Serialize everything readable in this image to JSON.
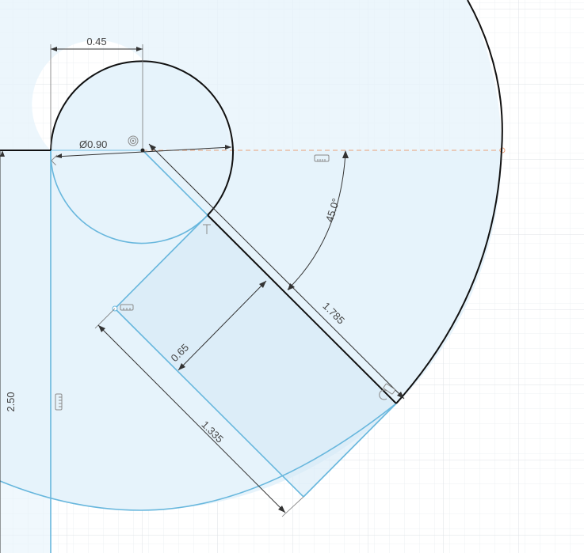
{
  "colors": {
    "background": "#ffffff",
    "grid_minor": "#eef0f3",
    "grid_major": "#dde1e6",
    "region_fill": "#e6f3fb",
    "sketch_line": "#68b7dd",
    "profile_line": "#111111",
    "dimension_line": "#333333",
    "construction_line": "#e8a07a"
  },
  "dimensions": {
    "horizontal_offset": "0.45",
    "circle_diameter": "Ø0.90",
    "angle": "45.0°",
    "edge_length": "1.785",
    "rect_width": "0.65",
    "rect_length": "1.335",
    "vertical_height": "2.50"
  },
  "constraint_icons": [
    "concentric-icon",
    "horizontal-constraint-icon",
    "tangent-icon",
    "perpendicular-icon",
    "coincident-icon",
    "coincident-icon",
    "vertical-constraint-icon"
  ]
}
